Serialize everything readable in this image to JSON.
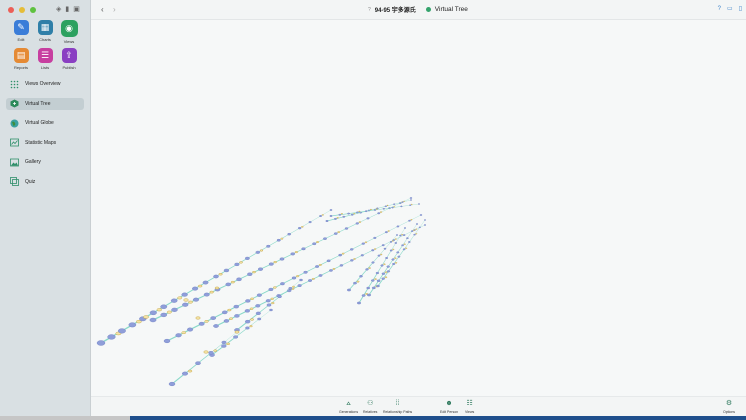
{
  "window": {
    "person_label": "94-95 宇多源氏",
    "view_label": "Virtual Tree"
  },
  "sidebar": {
    "modules": [
      {
        "label": "Edit",
        "icon": "pencil-icon",
        "color": "#3b7dd8"
      },
      {
        "label": "Charts",
        "icon": "charts-icon",
        "color": "#2f7fa8"
      },
      {
        "label": "Views",
        "icon": "eye-icon",
        "color": "#2da160"
      },
      {
        "label": "Reports",
        "icon": "reports-icon",
        "color": "#e58a34"
      },
      {
        "label": "Lists",
        "icon": "lists-icon",
        "color": "#c73fa0"
      },
      {
        "label": "Publish",
        "icon": "publish-icon",
        "color": "#8a3fc2"
      }
    ],
    "nav_items": [
      {
        "label": "Views Overview",
        "icon": "grid-dots-icon"
      },
      {
        "label": "Virtual Tree",
        "icon": "tree-cube-icon"
      },
      {
        "label": "Virtual Globe",
        "icon": "globe-icon"
      },
      {
        "label": "Statistic Maps",
        "icon": "statistic-map-icon"
      },
      {
        "label": "Gallery",
        "icon": "gallery-icon"
      },
      {
        "label": "Quiz",
        "icon": "quiz-icon"
      }
    ]
  },
  "bottombar": {
    "generations": "Generations",
    "relatives": "Relatives",
    "relationship_paths": "Relationship Paths",
    "edit_person": "Edit Person",
    "views": "Views",
    "options": "Options"
  },
  "colors": {
    "accent": "#2f7a5e",
    "link_line": "#7fd6c4",
    "node_fill": "#8f9ed9"
  }
}
